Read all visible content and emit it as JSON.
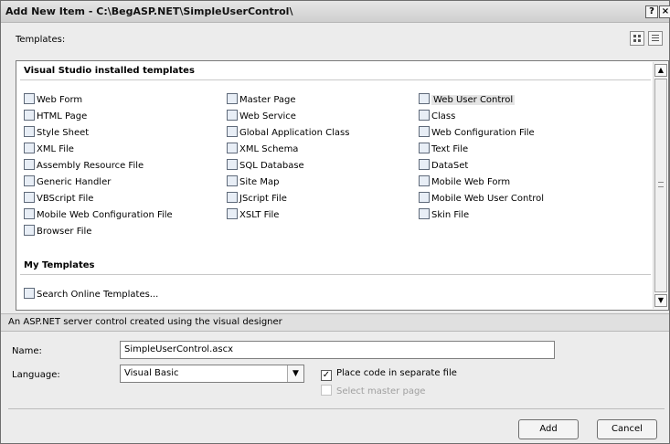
{
  "window": {
    "title": "Add New Item - C:\\BegASP.NET\\SimpleUserControl\\",
    "help_glyph": "?",
    "close_glyph": "×"
  },
  "templates_label": "Templates:",
  "sections": {
    "vs_header": "Visual Studio installed templates",
    "my_header": "My Templates"
  },
  "installed_templates": [
    {
      "label": "Web Form",
      "icon": "web-form-icon"
    },
    {
      "label": "HTML Page",
      "icon": "html-page-icon"
    },
    {
      "label": "Style Sheet",
      "icon": "style-sheet-icon"
    },
    {
      "label": "XML File",
      "icon": "xml-file-icon"
    },
    {
      "label": "Assembly Resource File",
      "icon": "assembly-resource-icon"
    },
    {
      "label": "Generic Handler",
      "icon": "generic-handler-icon"
    },
    {
      "label": "VBScript File",
      "icon": "vbscript-icon"
    },
    {
      "label": "Mobile Web Configuration File",
      "icon": "mobile-config-icon"
    },
    {
      "label": "Browser File",
      "icon": "browser-file-icon"
    },
    {
      "label": "Master Page",
      "icon": "master-page-icon"
    },
    {
      "label": "Web Service",
      "icon": "web-service-icon"
    },
    {
      "label": "Global Application Class",
      "icon": "global-app-icon"
    },
    {
      "label": "XML Schema",
      "icon": "xml-schema-icon"
    },
    {
      "label": "SQL Database",
      "icon": "sql-database-icon"
    },
    {
      "label": "Site Map",
      "icon": "site-map-icon"
    },
    {
      "label": "JScript File",
      "icon": "jscript-icon"
    },
    {
      "label": "XSLT File",
      "icon": "xslt-icon"
    },
    {
      "label": "Web User Control",
      "icon": "web-user-control-icon"
    },
    {
      "label": "Class",
      "icon": "class-icon"
    },
    {
      "label": "Web Configuration File",
      "icon": "web-config-icon"
    },
    {
      "label": "Text File",
      "icon": "text-file-icon"
    },
    {
      "label": "DataSet",
      "icon": "dataset-icon"
    },
    {
      "label": "Mobile Web Form",
      "icon": "mobile-web-form-icon"
    },
    {
      "label": "Mobile Web User Control",
      "icon": "mobile-user-control-icon"
    },
    {
      "label": "Skin File",
      "icon": "skin-file-icon"
    }
  ],
  "my_templates": [
    {
      "label": "Search Online Templates...",
      "icon": "search-online-icon"
    }
  ],
  "description": "An ASP.NET server control created using the visual designer",
  "form": {
    "name_label": "Name:",
    "name_value": "SimpleUserControl.ascx",
    "language_label": "Language:",
    "language_value": "Visual Basic",
    "separate_file_label": "Place code in separate file",
    "separate_file_checked": true,
    "master_page_label": "Select master page",
    "master_page_checked": false
  },
  "buttons": {
    "add": "Add",
    "cancel": "Cancel"
  },
  "colors": {
    "dialog_bg": "#ececec",
    "list_bg": "#ffffff",
    "selected_bg": "#e4e4e4",
    "disabled_text": "#a0a0a0"
  }
}
